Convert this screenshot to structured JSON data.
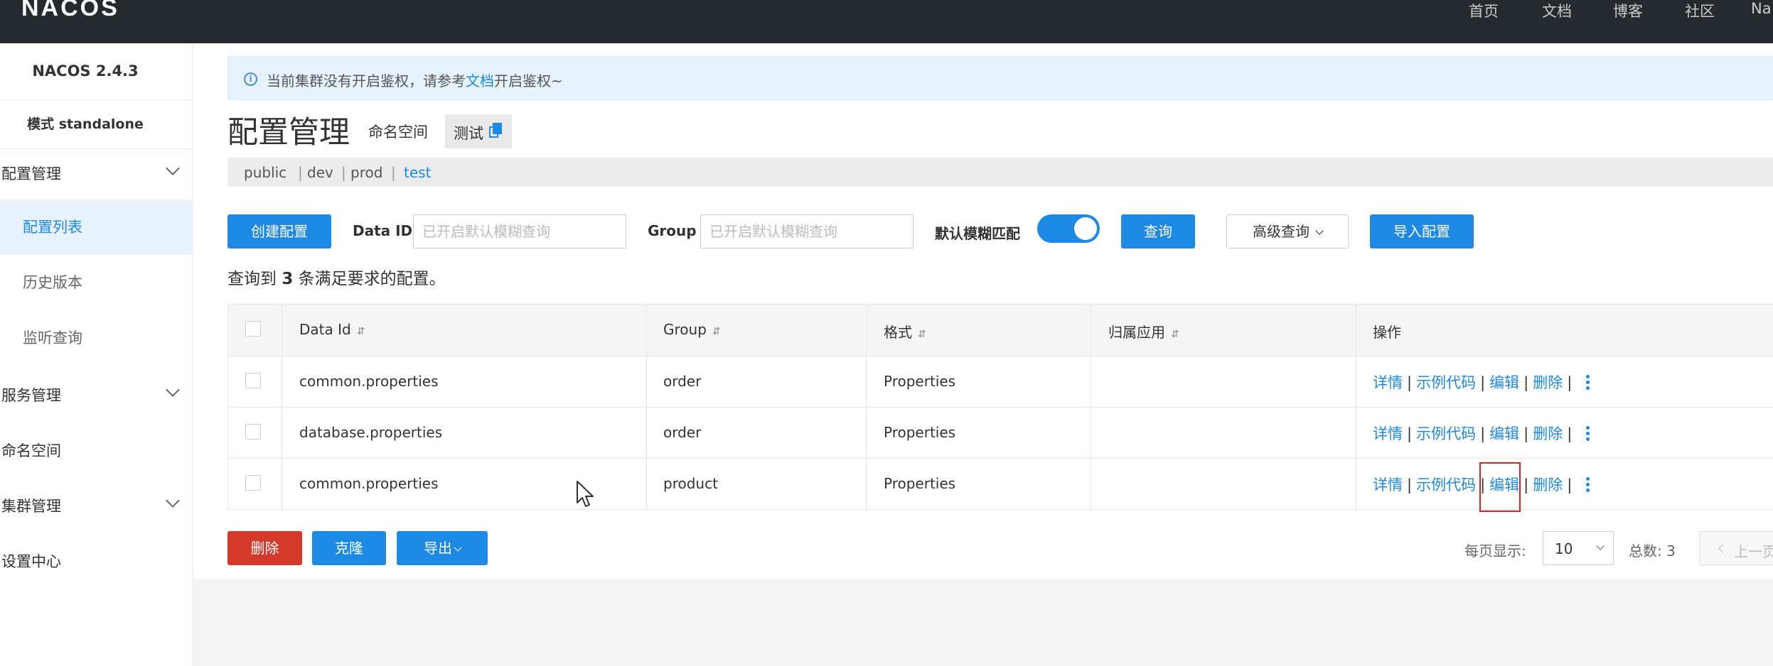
{
  "header": {
    "logo": "NACOS",
    "nav": [
      "首页",
      "文档",
      "博客",
      "社区",
      "Na"
    ]
  },
  "sidebar": {
    "title": "NACOS 2.4.3",
    "mode": "模式 standalone",
    "groups": {
      "config": "配置管理",
      "service": "服务管理",
      "namespace": "命名空间",
      "cluster": "集群管理",
      "settings": "设置中心"
    },
    "items": [
      "配置列表",
      "历史版本",
      "监听查询"
    ],
    "active_item": "配置列表"
  },
  "notice": {
    "before": "当前集群没有开启鉴权，请参考",
    "link": "文档",
    "after": "开启鉴权~"
  },
  "page": {
    "title": "配置管理",
    "namespace_label": "命名空间",
    "namespace_value": "测试"
  },
  "namespaces": [
    "public",
    "dev",
    "prod",
    "test"
  ],
  "namespace_separator": "|",
  "current_namespace": "test",
  "search": {
    "create_label": "创建配置",
    "data_id_label": "Data ID",
    "data_id_placeholder": "已开启默认模糊查询",
    "group_label": "Group",
    "group_placeholder": "已开启默认模糊查询",
    "fuzzy_label": "默认模糊匹配",
    "fuzzy_enabled": true,
    "query_label": "查询",
    "advanced_label": "高级查询",
    "import_label": "导入配置"
  },
  "result": {
    "prefix": "查询到",
    "count": "3",
    "suffix": "条满足要求的配置。"
  },
  "table": {
    "columns": [
      "Data Id",
      "Group",
      "格式",
      "归属应用",
      "操作"
    ],
    "sort_icon": "⇵",
    "rows": [
      {
        "data_id": "common.properties",
        "group": "order",
        "format": "Properties",
        "app": ""
      },
      {
        "data_id": "database.properties",
        "group": "order",
        "format": "Properties",
        "app": ""
      },
      {
        "data_id": "common.properties",
        "group": "product",
        "format": "Properties",
        "app": ""
      }
    ],
    "actions": {
      "detail": "详情",
      "sample": "示例代码",
      "edit": "编辑",
      "delete": "删除",
      "pipe": "|"
    }
  },
  "footer": {
    "delete_label": "删除",
    "clone_label": "克隆",
    "export_label": "导出",
    "page_size_label": "每页显示:",
    "page_size": "10",
    "total_label": "总数: 3",
    "prev_label": "上一页"
  },
  "colors": {
    "primary": "#1e88e5",
    "danger": "#d33a2c",
    "topbar": "#252a2f",
    "highlight": "#e02020"
  }
}
